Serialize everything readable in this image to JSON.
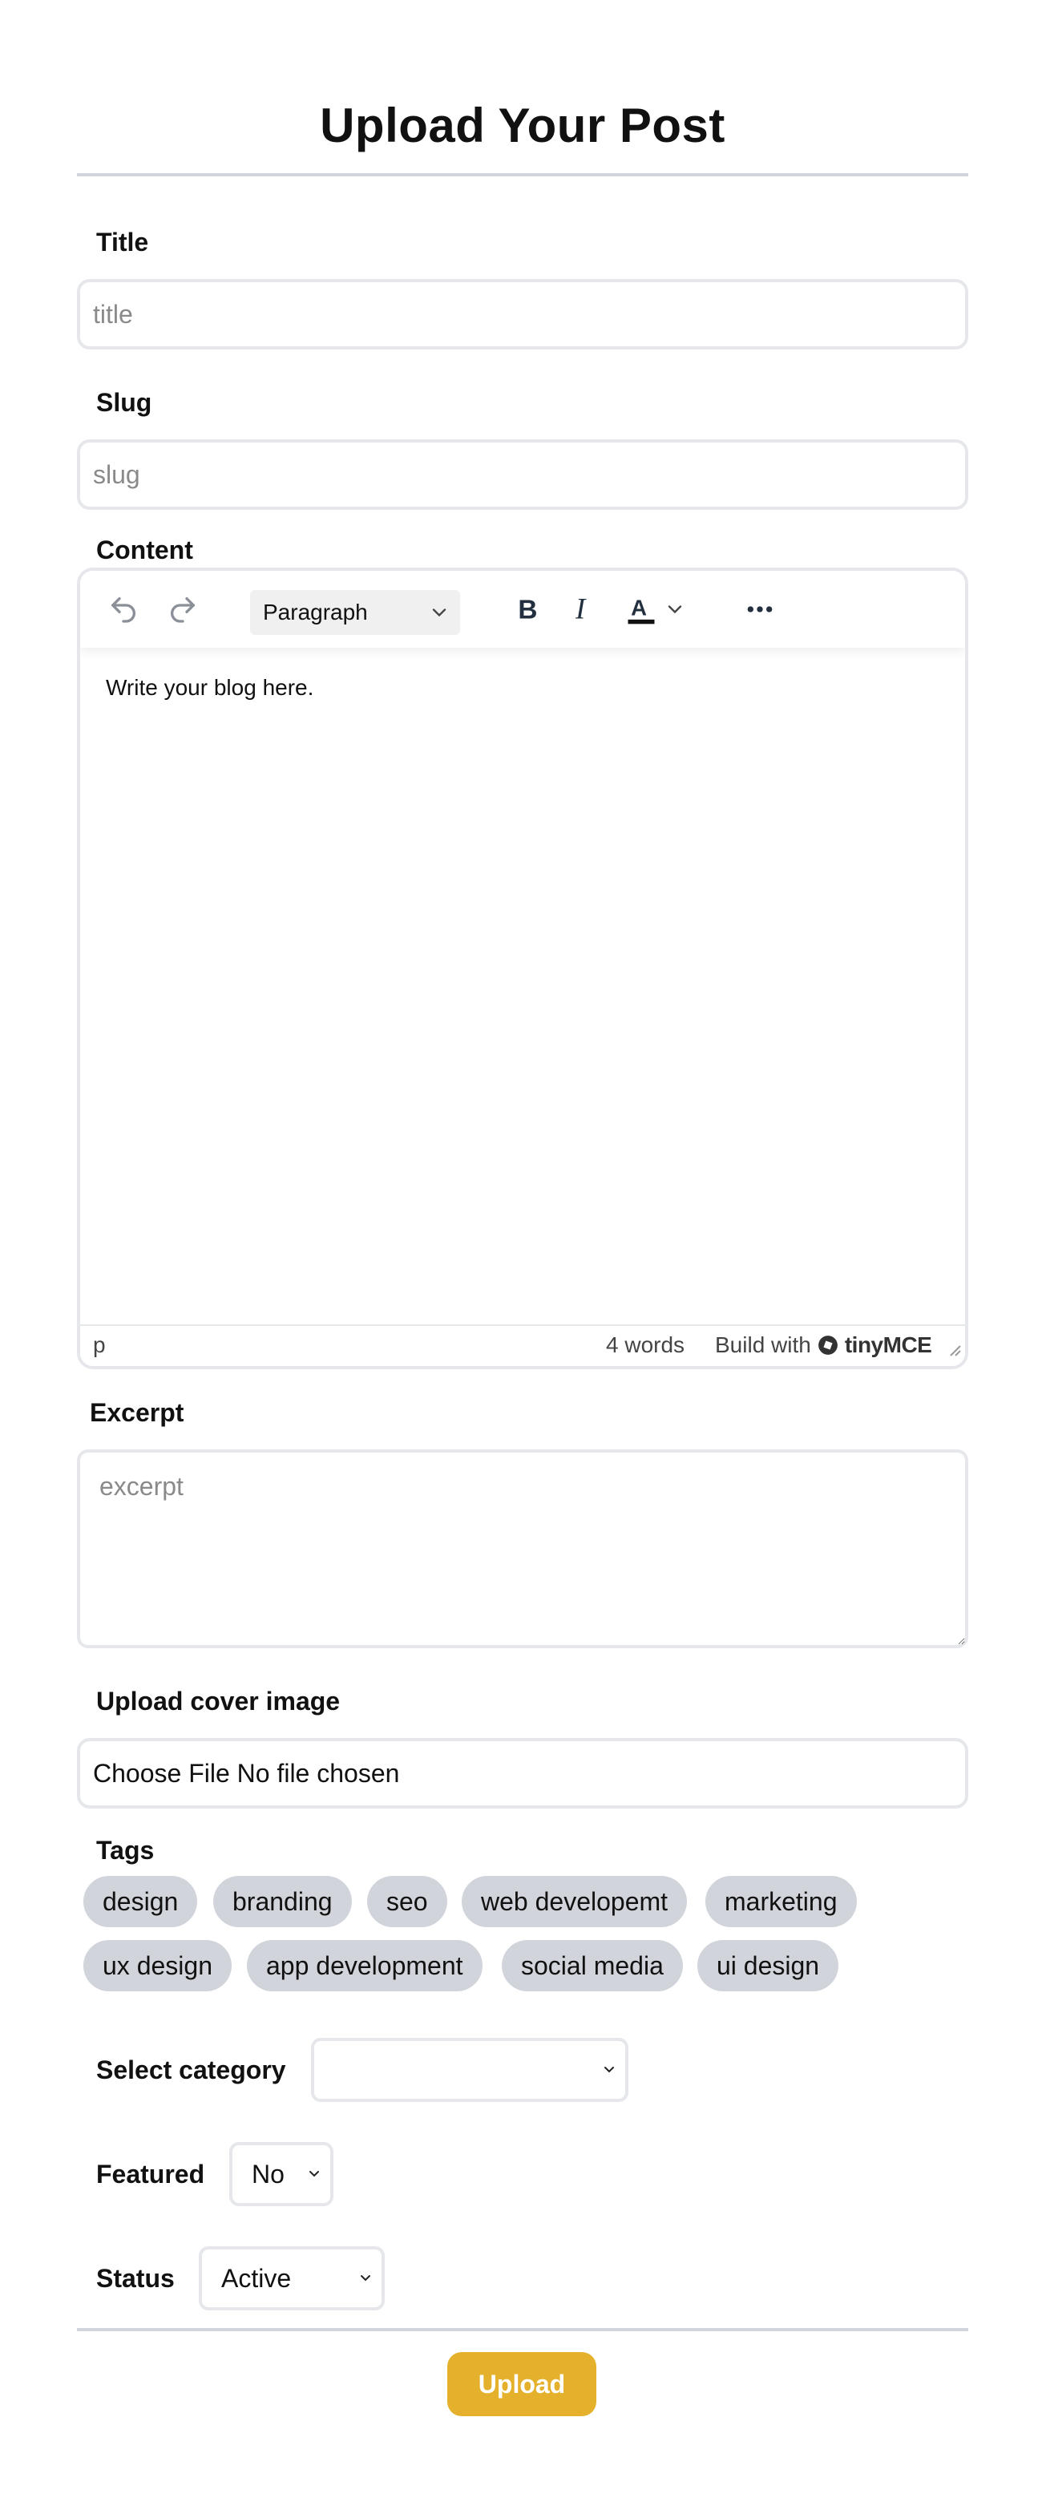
{
  "page": {
    "title": "Upload Your Post"
  },
  "form": {
    "title_label": "Title",
    "title_placeholder": "title",
    "slug_label": "Slug",
    "slug_placeholder": "slug",
    "content_label": "Content",
    "excerpt_label": "Excerpt",
    "excerpt_placeholder": "excerpt",
    "cover_label": "Upload cover image",
    "cover_file_text": "Choose File No file chosen",
    "tags_label": "Tags",
    "category_label": "Select category",
    "category_value": "",
    "featured_label": "Featured",
    "featured_value": "No",
    "status_label": "Status",
    "status_value": "Active",
    "submit_label": "Upload"
  },
  "editor": {
    "toolbar": {
      "undo_icon": "undo-icon",
      "redo_icon": "redo-icon",
      "block_format": "Paragraph",
      "bold_icon": "bold-icon",
      "italic_icon": "italic-icon",
      "text_color_icon": "text-color-icon",
      "more_icon": "more-icon"
    },
    "body_text": "Write your blog here.",
    "status": {
      "path": "p",
      "word_count": "4 words",
      "build_with": "Build with",
      "brand": "tinyMCE"
    }
  },
  "tags": [
    {
      "label": "design"
    },
    {
      "label": "branding"
    },
    {
      "label": "seo"
    },
    {
      "label": "web developemt"
    },
    {
      "label": "marketing"
    },
    {
      "label": "ux design"
    },
    {
      "label": "app development"
    },
    {
      "label": "social media"
    },
    {
      "label": "ui design"
    }
  ],
  "colors": {
    "accent": "#e5b12c",
    "tag_bg": "#d1d5db",
    "border": "#e5e7eb"
  }
}
